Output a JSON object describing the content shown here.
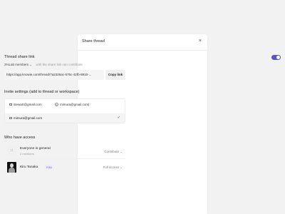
{
  "dialog": {
    "title": "Share thread",
    "close_label": "×"
  },
  "share_link": {
    "title": "Thread share link",
    "enabled": true,
    "permission_select": "2%Lab members",
    "permission_caret": "⌄",
    "permission_note": "with the share link can contribute",
    "url": "https://app.knowie.com/thread/7a2326ac-575c-42fb-8810-...",
    "copy_label": "Copy link"
  },
  "invite": {
    "title": "Invite settings (add to thread or workspace)",
    "chips": [
      "stewart@gmail.com",
      "mimura@gmail.com"
    ],
    "suggestion": "mimura@gmail.com",
    "check": "✓"
  },
  "access": {
    "title": "Who have access",
    "rows": [
      {
        "avatar": "∷",
        "name": "Everyone in general",
        "sub": "2 members",
        "role": "Contribute ⌄"
      },
      {
        "name": "Kiru Tanaka",
        "badge": "YOU",
        "role": "Full access ⌄"
      }
    ]
  },
  "colors": {
    "accent": "#5b51d1",
    "background": "#f2f2f2"
  }
}
